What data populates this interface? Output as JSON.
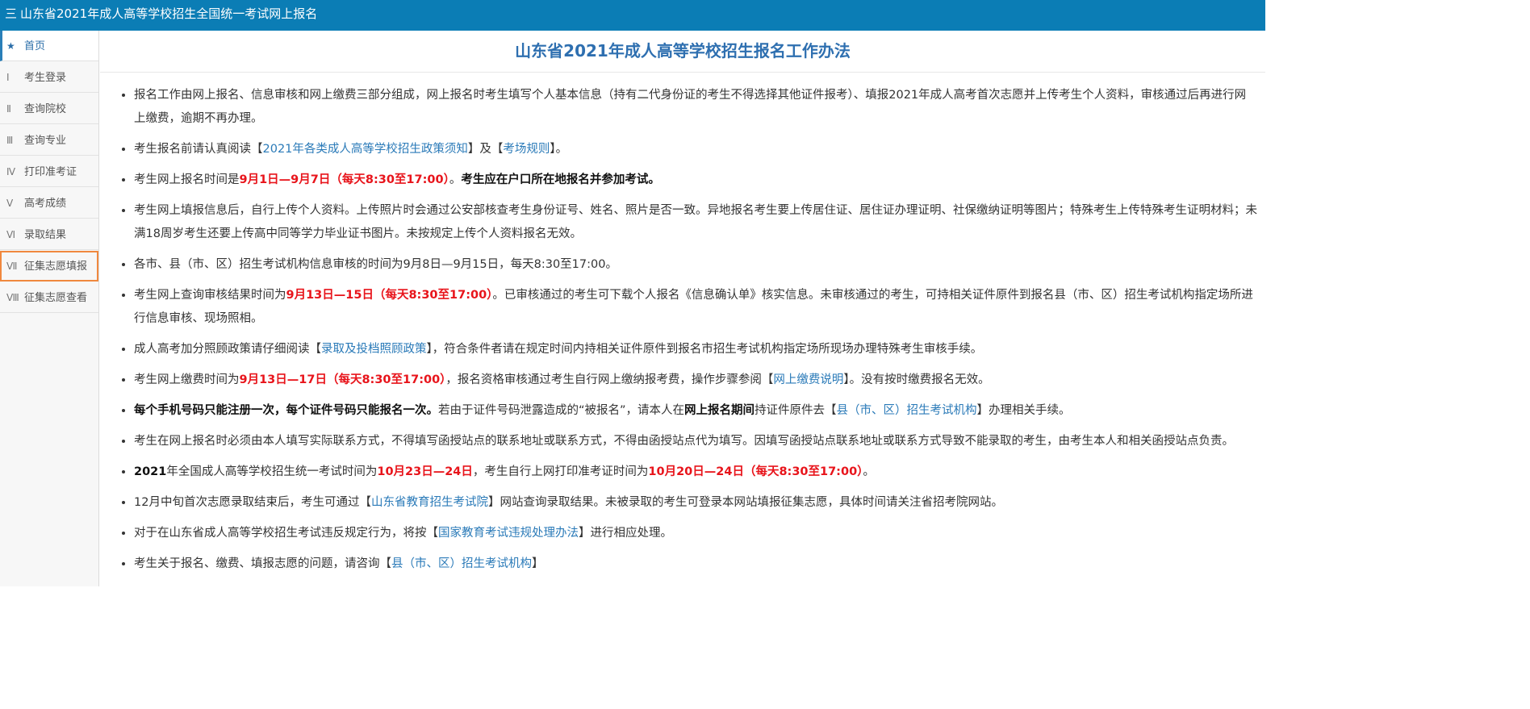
{
  "header": {
    "menu_icon": "hamburger-icon",
    "menu_glyph": "三",
    "title": "山东省2021年成人高等学校招生全国统一考试网上报名"
  },
  "sidebar": {
    "items": [
      {
        "num": "★",
        "label": "首页"
      },
      {
        "num": "Ⅰ",
        "label": "考生登录"
      },
      {
        "num": "Ⅱ",
        "label": "查询院校"
      },
      {
        "num": "Ⅲ",
        "label": "查询专业"
      },
      {
        "num": "Ⅳ",
        "label": "打印准考证"
      },
      {
        "num": "Ⅴ",
        "label": "高考成绩"
      },
      {
        "num": "Ⅵ",
        "label": "录取结果"
      },
      {
        "num": "Ⅶ",
        "label": "征集志愿填报"
      },
      {
        "num": "Ⅷ",
        "label": "征集志愿查看"
      }
    ]
  },
  "main": {
    "title": "山东省2021年成人高等学校招生报名工作办法",
    "items": [
      {
        "parts": [
          {
            "t": "报名工作由网上报名、信息审核和网上缴费三部分组成，网上报名时考生填写个人基本信息（持有二代身份证的考生不得选择其他证件报考）、填报2021年成人高考首次志愿并上传考生个人资料，审核通过后再进行网上缴费，逾期不再办理。",
            "s": "normal"
          }
        ]
      },
      {
        "parts": [
          {
            "t": "考生报名前请认真阅读【",
            "s": "normal"
          },
          {
            "t": "2021年各类成人高等学校招生政策须知",
            "s": "link"
          },
          {
            "t": "】及【",
            "s": "normal"
          },
          {
            "t": "考场规则",
            "s": "link"
          },
          {
            "t": "】。",
            "s": "normal"
          }
        ]
      },
      {
        "parts": [
          {
            "t": "考生网上报名时间是",
            "s": "normal"
          },
          {
            "t": "9月1日—9月7日（每天8:30至17:00）",
            "s": "red"
          },
          {
            "t": "。",
            "s": "normal"
          },
          {
            "t": "考生应在户口所在地报名并参加考试。",
            "s": "bold"
          }
        ]
      },
      {
        "parts": [
          {
            "t": "考生网上填报信息后，自行上传个人资料。上传照片时会通过公安部核查考生身份证号、姓名、照片是否一致。异地报名考生要上传居住证、居住证办理证明、社保缴纳证明等图片；特殊考生上传特殊考生证明材料；未满18周岁考生还要上传高中同等学力毕业证书图片。未按规定上传个人资料报名无效。",
            "s": "normal"
          }
        ]
      },
      {
        "parts": [
          {
            "t": "各市、县（市、区）招生考试机构信息审核的时间为9月8日—9月15日，每天8:30至17:00。",
            "s": "normal"
          }
        ]
      },
      {
        "parts": [
          {
            "t": "考生网上查询审核结果时间为",
            "s": "normal"
          },
          {
            "t": "9月13日—15日（每天8:30至17:00）",
            "s": "red"
          },
          {
            "t": "。已审核通过的考生可下载个人报名《信息确认单》核实信息。未审核通过的考生，可持相关证件原件到报名县（市、区）招生考试机构指定场所进行信息审核、现场照相。",
            "s": "normal"
          }
        ]
      },
      {
        "parts": [
          {
            "t": "成人高考加分照顾政策请仔细阅读【",
            "s": "normal"
          },
          {
            "t": "录取及投档照顾政策",
            "s": "link"
          },
          {
            "t": "】，符合条件者请在规定时间内持相关证件原件到报名市招生考试机构指定场所现场办理特殊考生审核手续。",
            "s": "normal"
          }
        ]
      },
      {
        "parts": [
          {
            "t": "考生网上缴费时间为",
            "s": "normal"
          },
          {
            "t": "9月13日—17日（每天8:30至17:00）",
            "s": "red"
          },
          {
            "t": "，报名资格审核通过考生自行网上缴纳报考费，操作步骤参阅【",
            "s": "normal"
          },
          {
            "t": "网上缴费说明",
            "s": "link"
          },
          {
            "t": "】。没有按时缴费报名无效。",
            "s": "normal"
          }
        ]
      },
      {
        "parts": [
          {
            "t": "每个手机号码只能注册一次，每个证件号码只能报名一次。",
            "s": "bold"
          },
          {
            "t": "若由于证件号码泄露造成的“被报名”，请本人在",
            "s": "normal"
          },
          {
            "t": "网上报名期间",
            "s": "bold"
          },
          {
            "t": "持证件原件去【",
            "s": "normal"
          },
          {
            "t": "县（市、区）招生考试机构",
            "s": "link"
          },
          {
            "t": "】办理相关手续。",
            "s": "normal"
          }
        ]
      },
      {
        "parts": [
          {
            "t": "考生在网上报名时必须由本人填写实际联系方式，不得填写函授站点的联系地址或联系方式，不得由函授站点代为填写。因填写函授站点联系地址或联系方式导致不能录取的考生，由考生本人和相关函授站点负责。",
            "s": "normal"
          }
        ]
      },
      {
        "parts": [
          {
            "t": "2021",
            "s": "bold"
          },
          {
            "t": "年全国成人高等学校招生统一考试时间为",
            "s": "normal"
          },
          {
            "t": "10月23日—24日",
            "s": "red"
          },
          {
            "t": "，考生自行上网打印准考证时间为",
            "s": "normal"
          },
          {
            "t": "10月20日—24日（每天8:30至17:00）",
            "s": "red"
          },
          {
            "t": "。",
            "s": "normal"
          }
        ]
      },
      {
        "parts": [
          {
            "t": "12月中旬首次志愿录取结束后，考生可通过【",
            "s": "normal"
          },
          {
            "t": "山东省教育招生考试院",
            "s": "link"
          },
          {
            "t": "】网站查询录取结果。未被录取的考生可登录本网站填报征集志愿，具体时间请关注省招考院网站。",
            "s": "normal"
          }
        ]
      },
      {
        "parts": [
          {
            "t": "对于在山东省成人高等学校招生考试违反规定行为，将按【",
            "s": "normal"
          },
          {
            "t": "国家教育考试违规处理办法",
            "s": "link"
          },
          {
            "t": "】进行相应处理。",
            "s": "normal"
          }
        ]
      },
      {
        "parts": [
          {
            "t": "考生关于报名、缴费、填报志愿的问题，请咨询【",
            "s": "normal"
          },
          {
            "t": "县（市、区）招生考试机构",
            "s": "link"
          },
          {
            "t": "】",
            "s": "normal"
          }
        ]
      }
    ]
  },
  "colors": {
    "header_bg": "#0b7db5",
    "title": "#2e6fb0",
    "red": "#e8141b",
    "link": "#2a7ab8",
    "highlight_outline": "#f0883e"
  }
}
